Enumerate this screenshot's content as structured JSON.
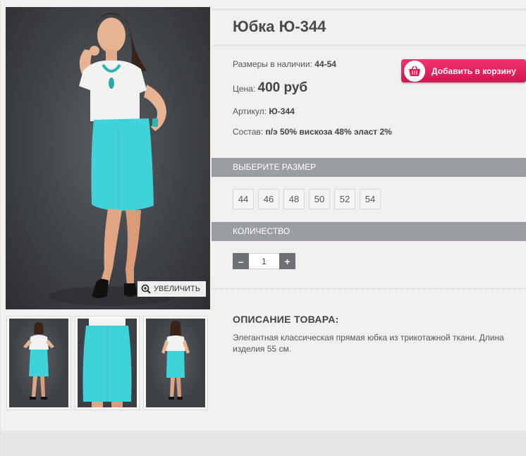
{
  "product": {
    "title": "Юбка Ю-344",
    "sizes_label": "Размеры в наличии:",
    "sizes_value": "44-54",
    "price_label": "Цена:",
    "price_value": "400 руб",
    "article_label": "Артикул:",
    "article_value": "Ю-344",
    "composition_label": "Состав:",
    "composition_value": "п/э 50% вискоза 48% эласт 2%"
  },
  "cart": {
    "button_label": "Добавить в корзину",
    "icon": "basket-icon"
  },
  "gallery": {
    "zoom_label": "УВЕЛИЧИТЬ",
    "zoom_icon": "magnifier-plus-icon",
    "thumbnails": [
      "model-front",
      "skirt-closeup",
      "model-back"
    ]
  },
  "size_section": {
    "title": "ВЫБЕРИТЕ РАЗМЕР",
    "options": [
      "44",
      "46",
      "48",
      "50",
      "52",
      "54"
    ]
  },
  "quantity_section": {
    "title": "КОЛИЧЕСТВО",
    "minus": "–",
    "plus": "+",
    "value": "1"
  },
  "description": {
    "title": "ОПИСАНИЕ ТОВАРА:",
    "text": "Элегантная классическая прямая юбка из трикотажной ткани. Длина изделия 55 см."
  },
  "colors": {
    "accent": "#e11d57",
    "section_bar": "#9a9ea3",
    "skirt": "#3fd3d9"
  }
}
